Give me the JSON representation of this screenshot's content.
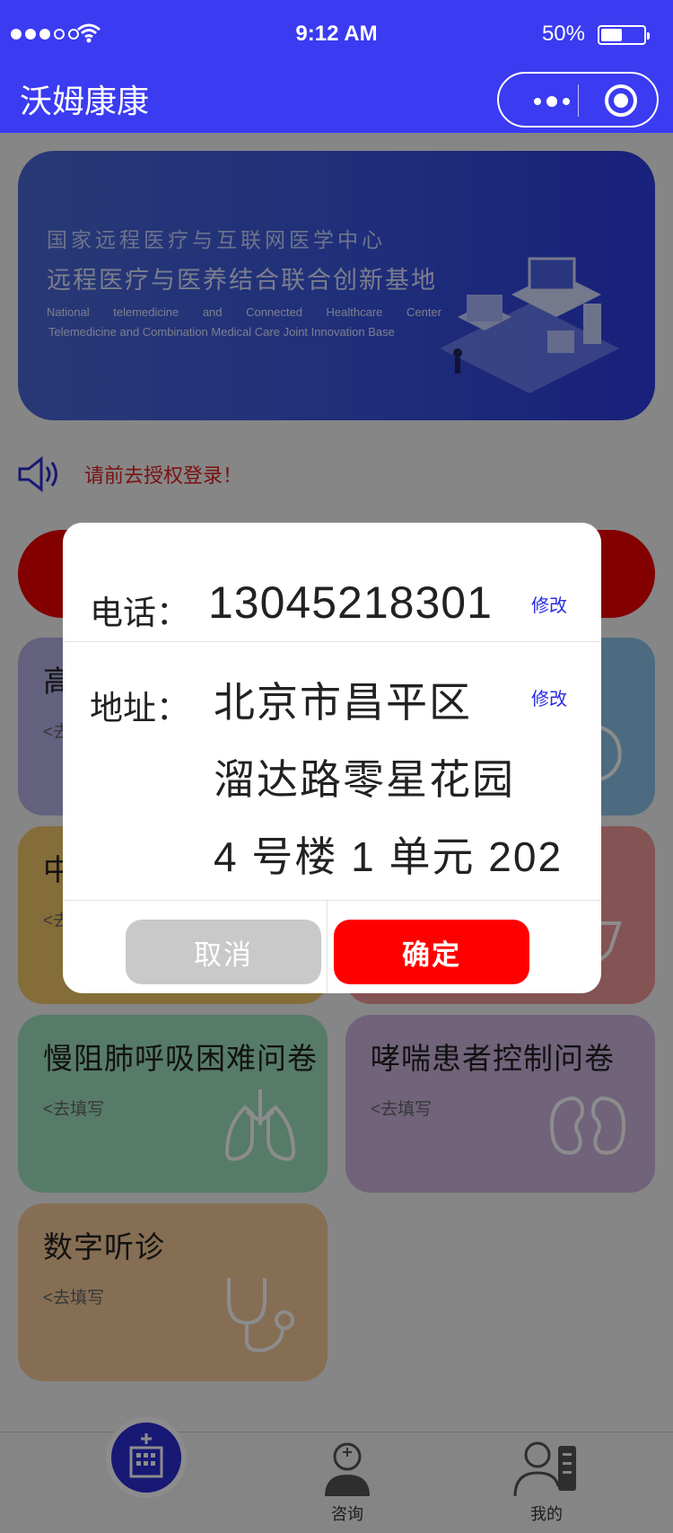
{
  "status_bar": {
    "time": "9:12 AM",
    "battery": "50%",
    "battery_level": 0.5
  },
  "nav": {
    "title": "沃姆康康"
  },
  "banner": {
    "line1": "国家远程医疗与互联网医学中心",
    "line2": "远程医疗与医养结合联合创新基地",
    "line3": "National telemedicine and Connected Healthcare Center",
    "line4": "Telemedicine and Combination Medical Care Joint Innovation Base"
  },
  "notice": {
    "text": "请前去授权登录！"
  },
  "cards": [
    {
      "title": "高",
      "sub": "<去",
      "color": "#b5b1e6"
    },
    {
      "title": "",
      "sub": "",
      "color": "#8dc4ea"
    },
    {
      "title": "中",
      "sub": "<去",
      "color": "#f3c769"
    },
    {
      "title": "",
      "sub": "",
      "color": "#f19a99"
    },
    {
      "title": "慢阻肺呼吸困难问卷",
      "sub": "<去填写",
      "color": "#9ee0bf"
    },
    {
      "title": "哮喘患者控制问卷",
      "sub": "<去填写",
      "color": "#cdb5df"
    },
    {
      "title": "数字听诊",
      "sub": "<去填写",
      "color": "#f4c99a"
    }
  ],
  "modal": {
    "phone_label": "电话：",
    "phone_value": "13045218301",
    "edit_label": "修改",
    "address_label": "地址：",
    "address_lines": [
      "北京市昌平区",
      "溜达路零星花园",
      "4 号楼 1 单元 202"
    ],
    "cancel": "取消",
    "confirm": "确定"
  },
  "tabs": {
    "consult": "咨询",
    "mine": "我的"
  }
}
